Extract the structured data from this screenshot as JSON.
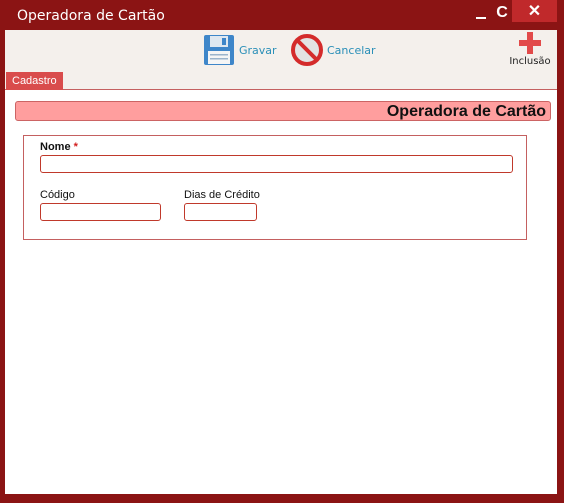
{
  "window": {
    "title": "Operadora de Cartão",
    "refresh_glyph": "C",
    "close_glyph": "✕"
  },
  "toolbar": {
    "save_label": "Gravar",
    "cancel_label": "Cancelar",
    "add_label": "Inclusão"
  },
  "tabs": [
    {
      "label": "Cadastro"
    }
  ],
  "form": {
    "header": "Operadora de Cartão",
    "fields": {
      "nome": {
        "label": "Nome",
        "required_mark": "*",
        "value": ""
      },
      "codigo": {
        "label": "Código",
        "value": ""
      },
      "dias_credito": {
        "label": "Dias de Crédito",
        "value": ""
      }
    }
  },
  "colors": {
    "frame": "#8b1414",
    "close": "#c0292b",
    "tab": "#d94c4c",
    "header": "#ff9e9e",
    "accent_text": "#2a8fb8"
  },
  "icons": {
    "save": "floppy-disk-icon",
    "cancel": "no-entry-icon",
    "add": "plus-icon",
    "minimize": "minimize-icon",
    "refresh": "refresh-icon",
    "close": "close-icon"
  }
}
